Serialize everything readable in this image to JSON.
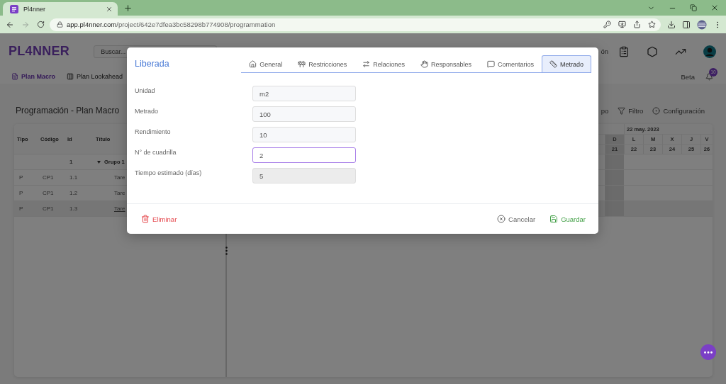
{
  "browser": {
    "tab_title": "Pl4nner",
    "url_host": "app.pl4nner.com",
    "url_path": "/project/642e7dfea3bc58298b774908/programmation",
    "can_go_forward": false
  },
  "app_header": {
    "logo": "PL4NNER",
    "search": {
      "placeholder": "Buscar..."
    },
    "label_fragment": "ón"
  },
  "nav": {
    "items": [
      {
        "kind": "document",
        "label": "Plan Macro",
        "selected": true
      },
      {
        "kind": "columns",
        "label": "Plan Lookahead",
        "selected": false
      }
    ],
    "beta_label": "Beta",
    "notification_count": "10"
  },
  "page": {
    "title": "Programación - Plan Macro",
    "toolbar": [
      {
        "kind": "fragment",
        "label": "po"
      },
      {
        "kind": "filter",
        "label": "Filtro"
      },
      {
        "kind": "settings",
        "label": "Configuración"
      }
    ]
  },
  "table": {
    "columns": [
      "Tipo",
      "Código",
      "Id",
      "Título"
    ],
    "rows": [
      {
        "kind": "group",
        "id": "1",
        "title": "Grupo 1",
        "expanded": true,
        "selected": false
      },
      {
        "kind": "task",
        "type": "P",
        "code": "CP1",
        "id": "1.1",
        "title": "Tare",
        "selected": false
      },
      {
        "kind": "task",
        "type": "P",
        "code": "CP1",
        "id": "1.2",
        "title": "Tare",
        "selected": false
      },
      {
        "kind": "task",
        "type": "P",
        "code": "CP1",
        "id": "1.3",
        "title": "Tare",
        "selected": true
      }
    ]
  },
  "gantt": {
    "week_label": "22 may. 2023",
    "days": [
      {
        "letter": "D",
        "number": "21",
        "weekend": true
      },
      {
        "letter": "L",
        "number": "22",
        "weekend": false
      },
      {
        "letter": "M",
        "number": "23",
        "weekend": false
      },
      {
        "letter": "X",
        "number": "24",
        "weekend": false
      },
      {
        "letter": "J",
        "number": "25",
        "weekend": false
      },
      {
        "letter": "V",
        "number": "26",
        "weekend": false
      }
    ]
  },
  "modal": {
    "title": "Liberada",
    "tabs": [
      {
        "kind": "general",
        "label": "General",
        "selected": false
      },
      {
        "kind": "restrictions",
        "label": "Restricciones",
        "selected": false
      },
      {
        "kind": "relations",
        "label": "Relaciones",
        "selected": false
      },
      {
        "kind": "responsibles",
        "label": "Responsables",
        "selected": false
      },
      {
        "kind": "comments",
        "label": "Comentarios",
        "selected": false
      },
      {
        "kind": "measure",
        "label": "Metrado",
        "selected": true
      }
    ],
    "fields": [
      {
        "label": "Unidad",
        "value": "m2",
        "focused": false,
        "disabled": false
      },
      {
        "label": "Metrado",
        "value": "100",
        "focused": false,
        "disabled": false
      },
      {
        "label": "Rendimiento",
        "value": "10",
        "focused": false,
        "disabled": false
      },
      {
        "label": "N° de cuadrilla",
        "value": "2",
        "focused": true,
        "disabled": false
      },
      {
        "label": "Tiempo estimado (días)",
        "value": "5",
        "focused": false,
        "disabled": true
      }
    ],
    "actions": [
      {
        "kind": "delete",
        "label": "Eliminar"
      },
      {
        "kind": "cancel",
        "label": "Cancelar"
      },
      {
        "kind": "save",
        "label": "Guardar"
      }
    ]
  }
}
